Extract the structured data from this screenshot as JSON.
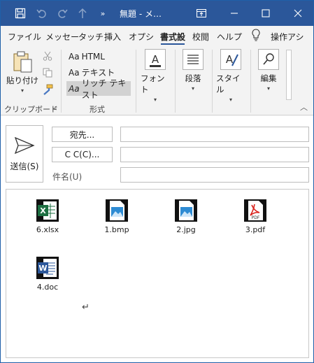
{
  "window": {
    "title": "無題 - メ…",
    "controls": [
      "ribbon-display",
      "minimize",
      "maximize",
      "close"
    ]
  },
  "quick_access": [
    "save-icon",
    "undo-icon",
    "redo-icon",
    "up-arrow-icon",
    "more-icon"
  ],
  "tabs": [
    {
      "label": "ファイル"
    },
    {
      "label": "メッセー"
    },
    {
      "label": "タッチ"
    },
    {
      "label": "挿入"
    },
    {
      "label": "オプシ"
    },
    {
      "label": "書式設"
    },
    {
      "label": "校閲"
    },
    {
      "label": "ヘルプ"
    },
    {
      "label": "操作アシ"
    }
  ],
  "active_tab": "書式設",
  "ribbon": {
    "clipboard": {
      "paste_label": "貼り付け",
      "group_label": "クリップボード"
    },
    "format": {
      "group_label": "形式",
      "items": [
        {
          "aa": "Aa",
          "label": "HTML"
        },
        {
          "aa": "Aa",
          "label": "テキスト"
        },
        {
          "aa": "Aa",
          "label": "リッチ テキスト"
        }
      ],
      "selected": "リッチ テキスト"
    },
    "font_label": "フォント",
    "paragraph_label": "段落",
    "style_label": "スタイル",
    "edit_label": "編集"
  },
  "compose": {
    "send_label": "送信(S)",
    "to_label": "宛先...",
    "cc_label": "C C(C)...",
    "subject_label": "件名(U)",
    "to_value": "",
    "cc_value": "",
    "subject_value": ""
  },
  "attachments": [
    {
      "name": "6.xlsx",
      "icon": "excel-file-icon"
    },
    {
      "name": "1.bmp",
      "icon": "image-file-icon"
    },
    {
      "name": "2.jpg",
      "icon": "image-file-icon"
    },
    {
      "name": "3.pdf",
      "icon": "pdf-file-icon"
    },
    {
      "name": "4.doc",
      "icon": "word-file-icon"
    }
  ],
  "colors": {
    "titlebar": "#2b579a",
    "accent": "#2b579a",
    "excel": "#1d6f42",
    "word": "#2b579a",
    "pdf": "#d9231d"
  }
}
